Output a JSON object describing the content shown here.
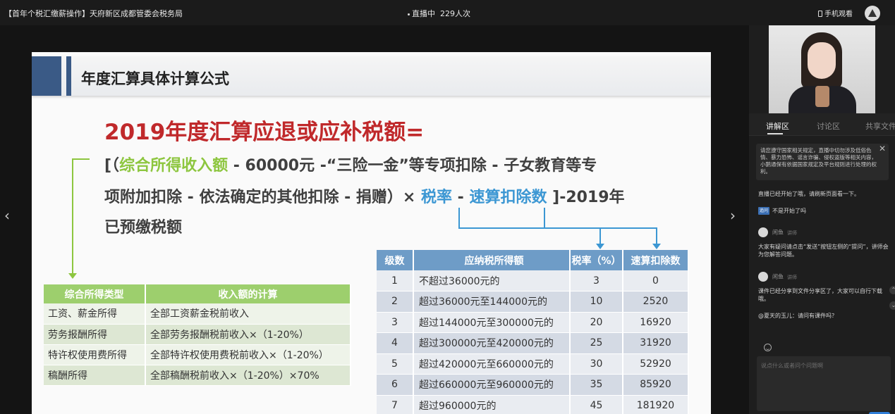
{
  "topbar": {
    "title": "【首年个税汇缴薪操作】天府新区成都管委会税务局",
    "live_status": "直播中",
    "viewers": "229人次",
    "mobile_watch": "手机观看"
  },
  "slide": {
    "heading": "年度汇算具体计算公式",
    "formula_title": "2019年度汇算应退或应补税额=",
    "formula": {
      "p1": "[（",
      "p2": "综合所得收入额",
      "p3": " - 60000元 -“三险一金”等专项扣除 - 子女教育等专",
      "p4": "项附加扣除 - 依法确定的其他扣除 - 捐赠）× ",
      "p5": "税率",
      "p6": " - ",
      "p7": "速算扣除数",
      "p8": "  ]-2019年",
      "p9": "已预缴税额"
    },
    "income_table": {
      "headers": [
        "综合所得类型",
        "收入额的计算"
      ],
      "rows": [
        [
          "工资、薪金所得",
          "全部工资薪金税前收入"
        ],
        [
          "劳务报酬所得",
          "全部劳务报酬税前收入×（1-20%）"
        ],
        [
          "特许权使用费所得",
          "全部特许权使用费税前收入×（1-20%）"
        ],
        [
          "稿酬所得",
          "全部稿酬税前收入×（1-20%）×70%"
        ]
      ]
    },
    "tax_table": {
      "headers": [
        "级数",
        "应纳税所得额",
        "税率（%）",
        "速算扣除数"
      ],
      "rows": [
        [
          "1",
          "不超过36000元的",
          "3",
          "0"
        ],
        [
          "2",
          "超过36000元至144000元的",
          "10",
          "2520"
        ],
        [
          "3",
          "超过144000元至300000元的",
          "20",
          "16920"
        ],
        [
          "4",
          "超过300000元至420000元的",
          "25",
          "31920"
        ],
        [
          "5",
          "超过420000元至660000元的",
          "30",
          "52920"
        ],
        [
          "6",
          "超过660000元至960000元的",
          "35",
          "85920"
        ],
        [
          "7",
          "超过960000元的",
          "45",
          "181920"
        ]
      ]
    }
  },
  "panel": {
    "tabs": [
      "讲解区",
      "讨论区",
      "共享文件"
    ],
    "notice": "请您遵守国家相关规定，直播中切勿涉及低俗色情、暴力恐怖、谣言诈骗、侵权盗版等相关内容，小鹅通保有依据国家规定及平台规则进行处理的权利。",
    "messages": {
      "m1": "直播已经开始了哦，请刷新页面看一下。",
      "reply_tag": "追问",
      "m2": "不是开始了吗",
      "user1": "闲鱼",
      "user1_role": "讲师",
      "m3": "大家有疑问请点击“发送”按钮左侧的“提问”，讲师会为您解答问题。",
      "user2": "闲鱼",
      "user2_role": "讲师",
      "m4": "课件已经分享到文件分享区了，大家可以自行下载哦。",
      "m5": "@夏天的玉儿：请问有课件吗？"
    },
    "input_placeholder": "说点什么或者问个问题啊"
  }
}
